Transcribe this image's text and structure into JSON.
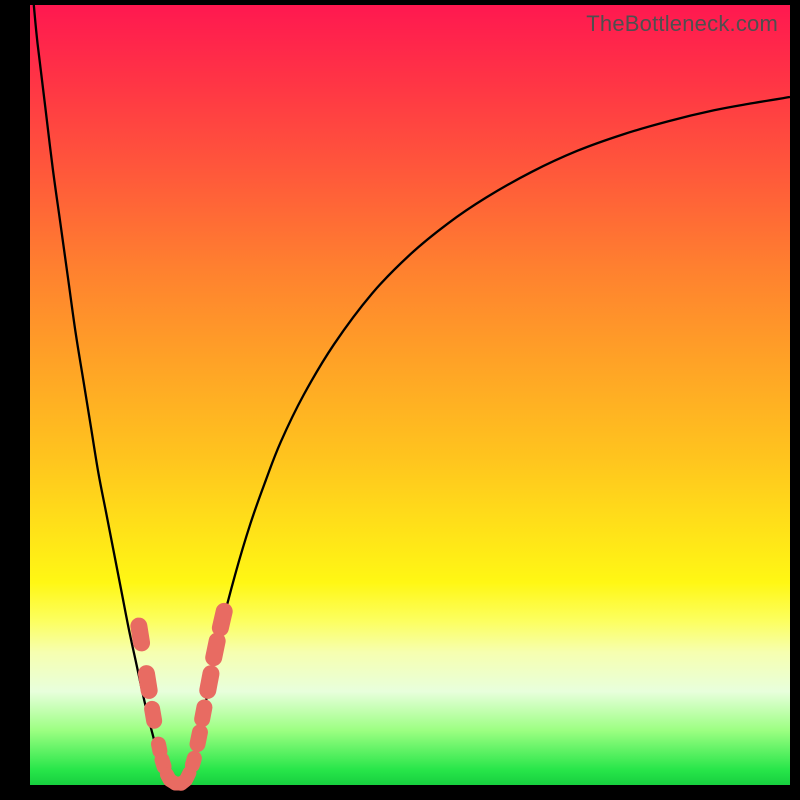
{
  "watermark": "TheBottleneck.com",
  "colors": {
    "frame": "#000000",
    "curve": "#000000",
    "marker": "#e86b62"
  },
  "chart_data": {
    "type": "line",
    "title": "",
    "xlabel": "",
    "ylabel": "",
    "xlim": [
      0,
      100
    ],
    "ylim": [
      0,
      100
    ],
    "x": [
      0.5,
      1,
      2,
      3,
      4,
      5,
      6,
      7,
      8,
      9,
      10,
      11,
      12,
      13,
      14,
      15,
      16,
      17,
      18,
      19,
      20,
      21,
      22,
      23,
      24,
      25,
      27,
      29,
      31,
      33,
      36,
      40,
      45,
      50,
      55,
      60,
      66,
      72,
      78,
      84,
      90,
      95,
      100
    ],
    "values": [
      100,
      95,
      87,
      79,
      72,
      65,
      58,
      52,
      46,
      40,
      35,
      30,
      25,
      20,
      15.5,
      11,
      7,
      3.5,
      1,
      0,
      0.3,
      2,
      5.5,
      10,
      15,
      19.5,
      27,
      33.5,
      39,
      44,
      50,
      56.5,
      63,
      68,
      72,
      75.3,
      78.6,
      81.3,
      83.4,
      85.1,
      86.5,
      87.4,
      88.2
    ],
    "markers": {
      "x": [
        14.5,
        15.5,
        16.2,
        17.0,
        17.5,
        18.2,
        18.8,
        19.5,
        20.2,
        20.8,
        21.5,
        22.2,
        22.8,
        23.6,
        24.4,
        25.3
      ],
      "y": [
        19.3,
        13.2,
        9.0,
        4.8,
        2.8,
        1.0,
        0.4,
        0.2,
        0.4,
        1.2,
        3.0,
        6.0,
        9.2,
        13.2,
        17.4,
        21.2
      ]
    },
    "gradient_bands": [
      {
        "y": 100,
        "color": "#ff1850"
      },
      {
        "y": 78,
        "color": "#ff5a3a"
      },
      {
        "y": 54,
        "color": "#ffa326"
      },
      {
        "y": 32,
        "color": "#ffe418"
      },
      {
        "y": 21,
        "color": "#fcff60"
      },
      {
        "y": 12,
        "color": "#e8ffdc"
      },
      {
        "y": 4,
        "color": "#28e64a"
      },
      {
        "y": 0,
        "color": "#17cf3f"
      }
    ]
  }
}
